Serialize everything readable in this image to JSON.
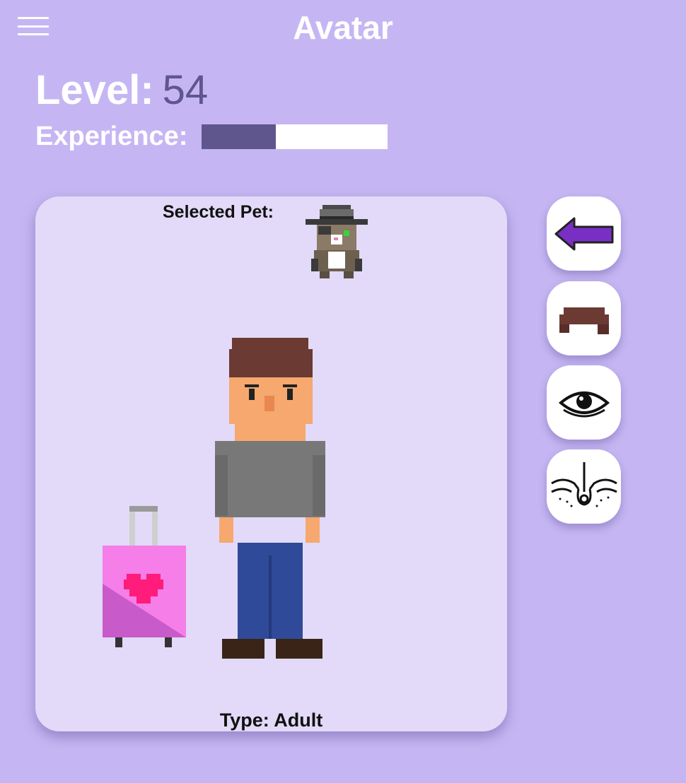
{
  "header": {
    "title": "Avatar"
  },
  "stats": {
    "level_label": "Level:",
    "level_value": "54",
    "experience_label": "Experience:",
    "experience_fraction": 0.4
  },
  "card": {
    "selected_pet_label": "Selected Pet:",
    "type_label": "Type: Adult"
  },
  "side_buttons": [
    {
      "icon": "back-arrow-icon"
    },
    {
      "icon": "hair-icon"
    },
    {
      "icon": "eye-icon"
    },
    {
      "icon": "skin-icon"
    }
  ],
  "colors": {
    "background": "#c5b6f3",
    "card": "#e2daf8",
    "accent": "#5e568d",
    "arrow": "#7a2fc4"
  }
}
